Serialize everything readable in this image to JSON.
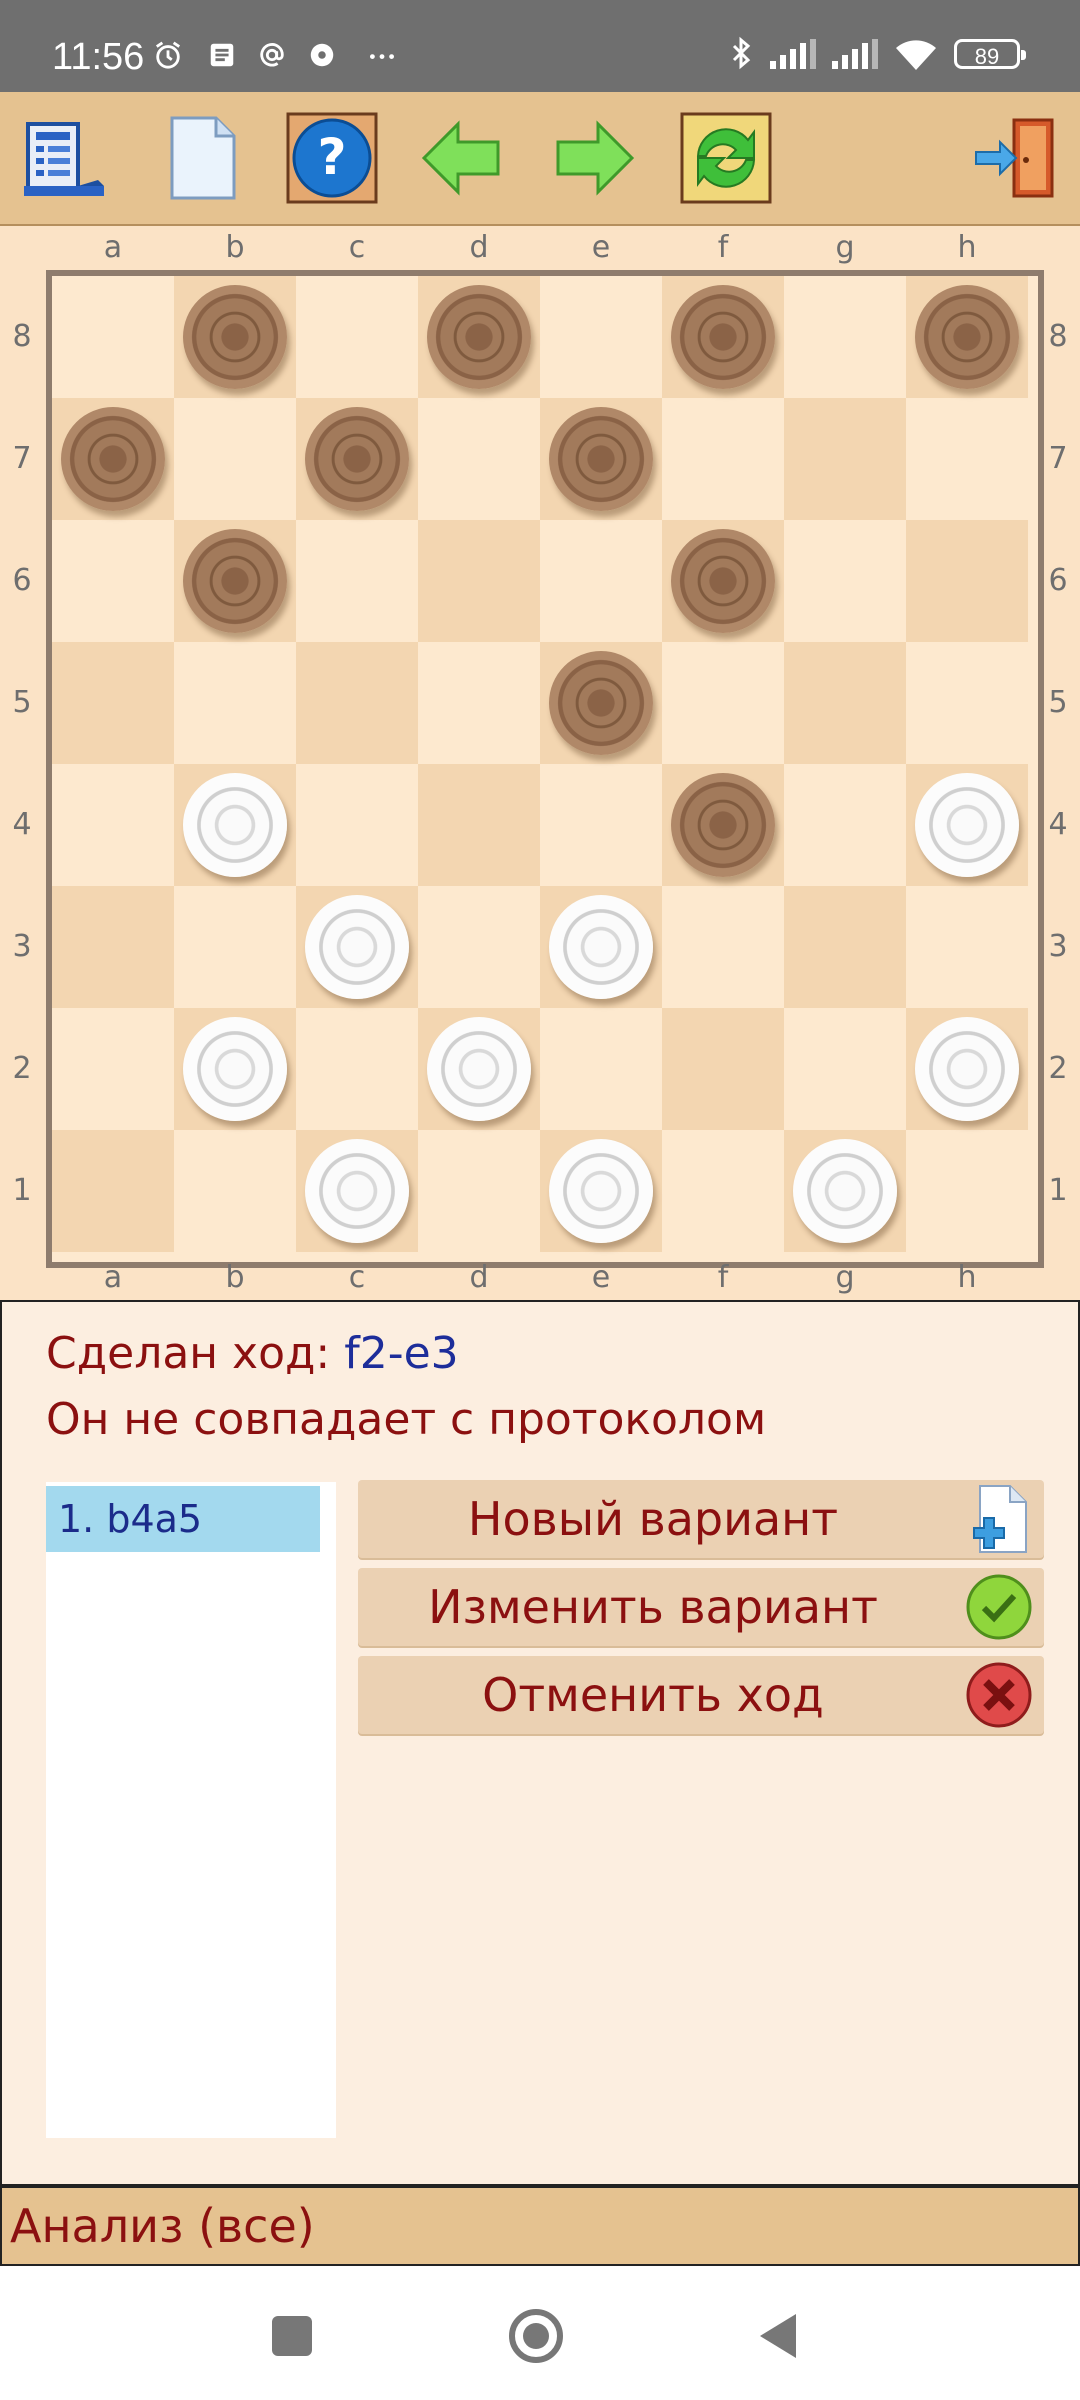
{
  "status_bar": {
    "time": "11:56",
    "battery": "89"
  },
  "toolbar": {
    "items": [
      {
        "name": "menu-icon"
      },
      {
        "name": "new-document-icon"
      },
      {
        "name": "help-icon"
      },
      {
        "name": "back-arrow-icon"
      },
      {
        "name": "forward-arrow-icon"
      },
      {
        "name": "flip-board-icon"
      },
      {
        "name": "exit-door-icon"
      }
    ]
  },
  "board": {
    "files": [
      "a",
      "b",
      "c",
      "d",
      "e",
      "f",
      "g",
      "h"
    ],
    "ranks": [
      "8",
      "7",
      "6",
      "5",
      "4",
      "3",
      "2",
      "1"
    ],
    "pieces": {
      "black": [
        "b8",
        "d8",
        "f8",
        "h8",
        "a7",
        "c7",
        "e7",
        "b6",
        "f6",
        "e5",
        "f4"
      ],
      "white": [
        "b4",
        "h4",
        "c3",
        "e3",
        "b2",
        "d2",
        "h2",
        "c1",
        "e1",
        "g1"
      ]
    },
    "colors": {
      "light": "#fde9cf",
      "dark": "#f3d6b1",
      "frame": "#8e7c6d"
    }
  },
  "panel": {
    "move_prefix": "Сделан ход: ",
    "move_value": "f2-e3",
    "mismatch_text": "Он не совпадает с протоколом",
    "move_list": [
      "1. b4a5"
    ],
    "buttons": {
      "new_variant": "Новый вариант",
      "change_variant": "Изменить вариант",
      "undo_move": "Отменить ход"
    }
  },
  "analysis_bar": {
    "label": "Анализ (все)"
  }
}
